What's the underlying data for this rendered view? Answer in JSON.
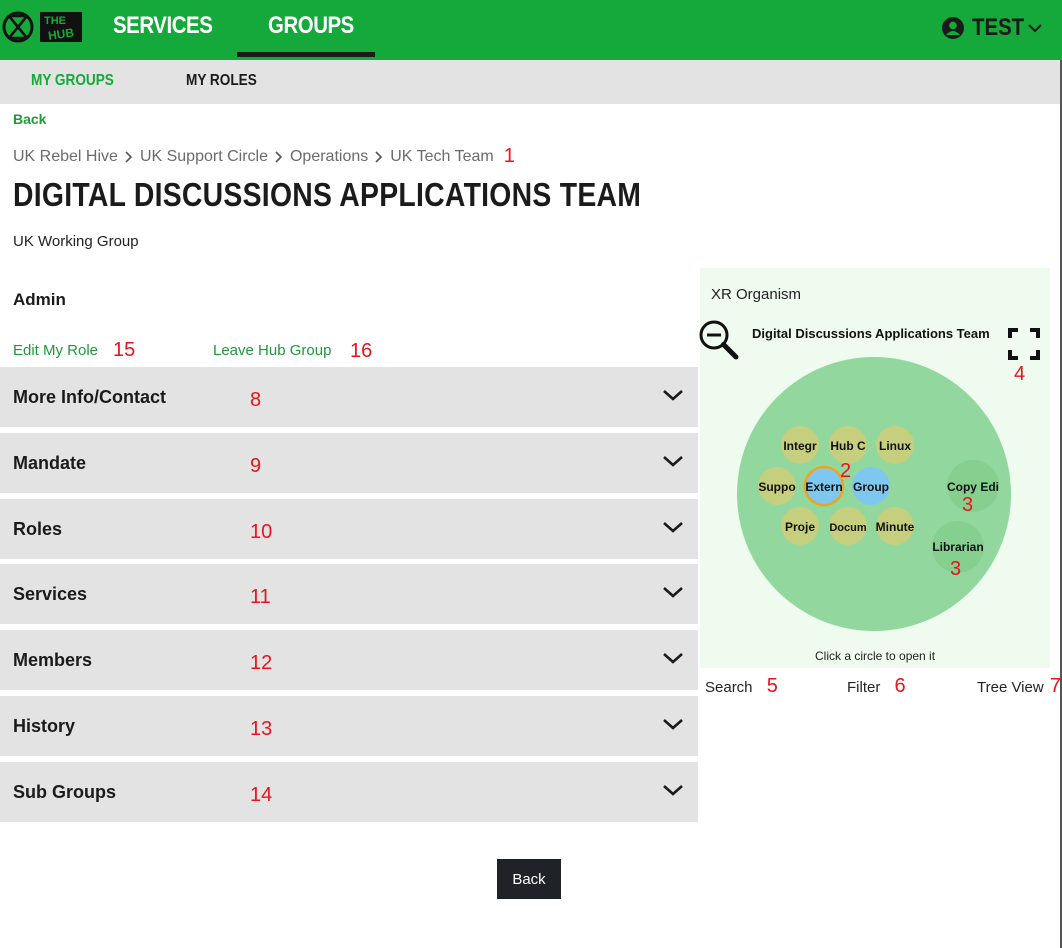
{
  "header": {
    "logo_text": "THE HUB",
    "nav": {
      "services": "SERVICES",
      "groups": "GROUPS"
    },
    "user": {
      "name": "TEST",
      "icon": "user-circle-icon"
    }
  },
  "subnav": {
    "my_groups": "MY GROUPS",
    "my_roles": "MY ROLES"
  },
  "page": {
    "back_label": "Back",
    "breadcrumb": [
      "UK Rebel Hive",
      "UK Support Circle",
      "Operations",
      "UK Tech Team"
    ],
    "breadcrumb_marker": "1",
    "title": "DIGITAL DISCUSSIONS APPLICATIONS TEAM",
    "group_type": "UK Working Group",
    "role_heading": "Admin",
    "edit_role": "Edit My Role",
    "edit_role_marker": "15",
    "leave_group": "Leave Hub Group",
    "leave_group_marker": "16"
  },
  "accordions": [
    {
      "label": "More Info/Contact",
      "marker": "8"
    },
    {
      "label": "Mandate",
      "marker": "9"
    },
    {
      "label": "Roles",
      "marker": "10"
    },
    {
      "label": "Services",
      "marker": "11"
    },
    {
      "label": "Members",
      "marker": "12"
    },
    {
      "label": "History",
      "marker": "13"
    },
    {
      "label": "Sub Groups",
      "marker": "14"
    }
  ],
  "organism": {
    "title": "XR Organism",
    "group_name": "Digital Discussions Applications Team",
    "fullscreen_marker": "4",
    "inner_marker": "2",
    "roles_marker": "3",
    "hint": "Click a circle to open it",
    "circles": [
      {
        "label": "Integr",
        "kind": "subgroup"
      },
      {
        "label": "Hub C",
        "kind": "subgroup"
      },
      {
        "label": "Linux",
        "kind": "subgroup"
      },
      {
        "label": "Suppo",
        "kind": "subgroup"
      },
      {
        "label": "Extern",
        "kind": "selected"
      },
      {
        "label": "Group",
        "kind": "blue"
      },
      {
        "label": "Proje",
        "kind": "subgroup"
      },
      {
        "label": "Docum",
        "kind": "subgroup"
      },
      {
        "label": "Minute",
        "kind": "subgroup"
      },
      {
        "label": "Copy Edi",
        "kind": "role"
      },
      {
        "label": "Librarian",
        "kind": "role"
      }
    ],
    "colors": {
      "outer": "#92d79e",
      "subgroup": "#c6cf7e",
      "blue": "#7ec8ef",
      "role": "#85d08f",
      "selected_ring": "#f0a41c"
    }
  },
  "viz_footer": {
    "search": "Search",
    "search_marker": "5",
    "filter": "Filter",
    "filter_marker": "6",
    "tree": "Tree View",
    "tree_marker": "7"
  },
  "bottom_back": "Back",
  "theme": {
    "brand_green": "#15a83a",
    "link_green": "#1e9a3a",
    "annotation_red": "#e8141b"
  }
}
